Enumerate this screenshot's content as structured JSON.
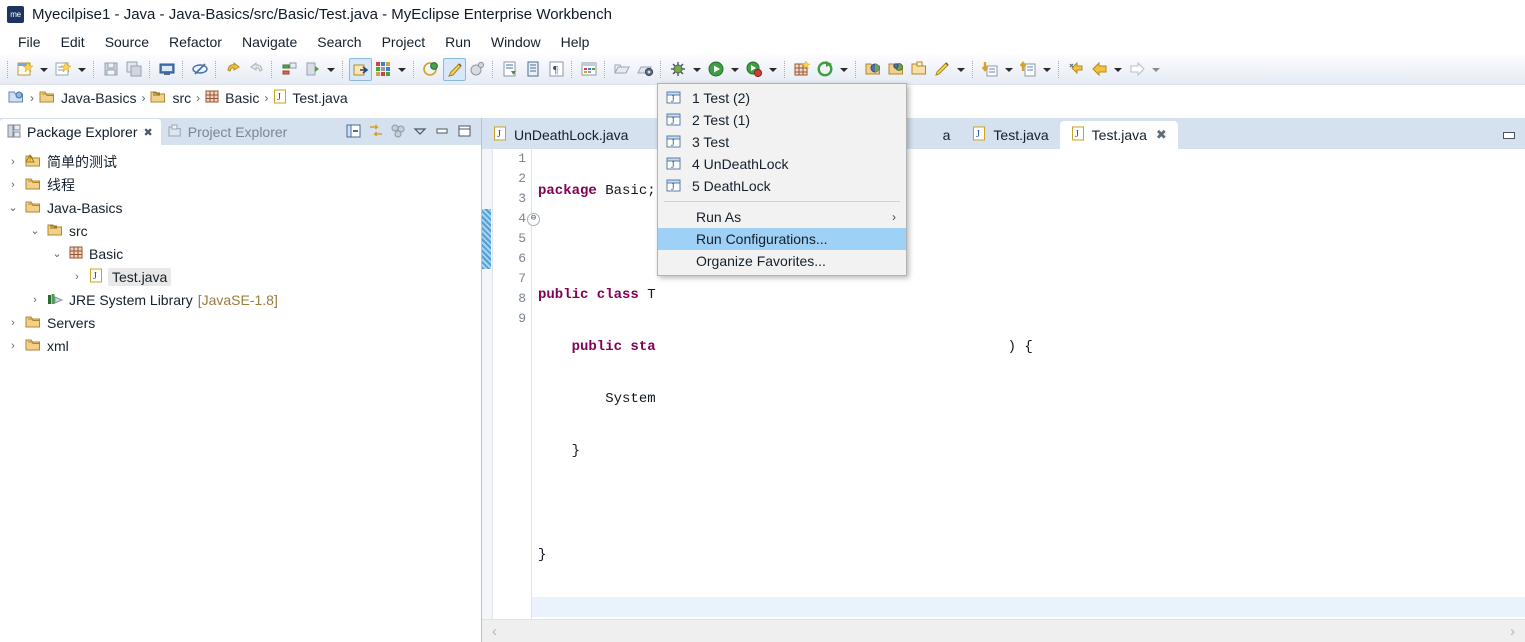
{
  "window": {
    "app_icon": "me",
    "title": "Myecilpise1 - Java - Java-Basics/src/Basic/Test.java - MyEclipse Enterprise Workbench"
  },
  "menubar": {
    "items": [
      {
        "label": "File"
      },
      {
        "label": "Edit"
      },
      {
        "label": "Source"
      },
      {
        "label": "Refactor"
      },
      {
        "label": "Navigate"
      },
      {
        "label": "Search"
      },
      {
        "label": "Project"
      },
      {
        "label": "Run"
      },
      {
        "label": "Window"
      },
      {
        "label": "Help"
      }
    ]
  },
  "toolbar": {
    "icons": [
      "new-wizard-icon",
      "new-wizard-dropdown",
      "new-java-class-icon",
      "new-java-class-dropdown",
      "save-icon",
      "save-all-icon",
      "console-icon",
      "no-marker-icon",
      "undo-icon",
      "redo-icon",
      "import-export-icon",
      "deploy-icon",
      "deploy-dropdown",
      "open-perspective-icon",
      "color-palette-icon",
      "color-palette-dropdown",
      "db-browser-icon",
      "paint-brush-icon",
      "properties-icon",
      "java-doc-icon",
      "open-type-icon",
      "pilcrow-icon",
      "table-icon",
      "open-resource-icon",
      "snapshot-icon",
      "debug-icon",
      "debug-dropdown",
      "run-icon",
      "run-dropdown",
      "run-error-icon",
      "run-error-dropdown",
      "new-table-icon",
      "refresh-icon",
      "refresh-dropdown",
      "open-package-icon",
      "open-folder-icon",
      "open-archive-icon",
      "pencil-icon",
      "pencil-dropdown",
      "download-icon",
      "download-dropdown",
      "upload-icon",
      "upload-dropdown",
      "back-history-icon",
      "back-icon",
      "back-dropdown",
      "forward-icon",
      "forward-dropdown"
    ]
  },
  "breadcrumb": {
    "items": [
      {
        "label": "",
        "icon": "workspace-icon"
      },
      {
        "label": "Java-Basics",
        "icon": "project-icon"
      },
      {
        "label": "src",
        "icon": "source-folder-icon"
      },
      {
        "label": "Basic",
        "icon": "package-icon"
      },
      {
        "label": "Test.java",
        "icon": "java-file-icon"
      }
    ],
    "separator": "›"
  },
  "explorer": {
    "tabs": [
      {
        "label": "Package Explorer",
        "active": true,
        "closable": true,
        "icon": "package-explorer-icon"
      },
      {
        "label": "Project Explorer",
        "active": false,
        "closable": false,
        "icon": "project-explorer-icon"
      }
    ],
    "tools": [
      "collapse-all-icon",
      "link-with-editor-icon",
      "view-menu-dots-icon",
      "view-menu-icon",
      "minimize-icon",
      "maximize-icon"
    ],
    "tree": [
      {
        "label": "简单的测试",
        "indent": 0,
        "twist": "collapsed",
        "icon": "project-warning-icon",
        "selected": false,
        "suffix": ""
      },
      {
        "label": "线程",
        "indent": 0,
        "twist": "collapsed",
        "icon": "project-icon",
        "selected": false,
        "suffix": ""
      },
      {
        "label": "Java-Basics",
        "indent": 0,
        "twist": "expanded",
        "icon": "project-icon",
        "selected": false,
        "suffix": ""
      },
      {
        "label": "src",
        "indent": 1,
        "twist": "expanded",
        "icon": "source-folder-icon",
        "selected": false,
        "suffix": ""
      },
      {
        "label": "Basic",
        "indent": 2,
        "twist": "expanded",
        "icon": "package-icon",
        "selected": false,
        "suffix": ""
      },
      {
        "label": "Test.java",
        "indent": 3,
        "twist": "collapsed",
        "icon": "java-file-icon",
        "selected": true,
        "suffix": ""
      },
      {
        "label": "JRE System Library",
        "indent": 1,
        "twist": "collapsed",
        "icon": "library-icon",
        "selected": false,
        "suffix": "[JavaSE-1.8]"
      },
      {
        "label": "Servers",
        "indent": 0,
        "twist": "collapsed",
        "icon": "project-icon",
        "selected": false,
        "suffix": ""
      },
      {
        "label": "xml",
        "indent": 0,
        "twist": "collapsed",
        "icon": "project-icon",
        "selected": false,
        "suffix": ""
      }
    ]
  },
  "editor": {
    "tabs": [
      {
        "label": "UnDeathLock.java",
        "active": false,
        "closable": false,
        "icon": "java-file-icon"
      },
      {
        "label": "a",
        "active": false,
        "closable": false,
        "icon": "java-file-icon"
      },
      {
        "label": "Test.java",
        "active": false,
        "closable": false,
        "icon": "java-file-icon"
      },
      {
        "label": "Test.java",
        "active": true,
        "closable": true,
        "icon": "java-file-icon"
      }
    ],
    "minimize_icon": "minimize-icon",
    "close_glyph": "✖",
    "lines": [
      {
        "num": "1",
        "fold": false,
        "current": false,
        "changed": false,
        "tokens": [
          {
            "t": "package ",
            "c": "kw"
          },
          {
            "t": "Basic;",
            "c": "plain"
          }
        ]
      },
      {
        "num": "2",
        "fold": false,
        "current": false,
        "changed": false,
        "tokens": []
      },
      {
        "num": "3",
        "fold": false,
        "current": false,
        "changed": false,
        "tokens": [
          {
            "t": "public class ",
            "c": "kw"
          },
          {
            "t": "T",
            "c": "plain"
          }
        ]
      },
      {
        "num": "4",
        "fold": true,
        "current": false,
        "changed": true,
        "tokens": [
          {
            "t": "    public sta",
            "c": "kw"
          }
        ]
      },
      {
        "num": "5",
        "fold": false,
        "current": false,
        "changed": true,
        "tokens": [
          {
            "t": "        System",
            "c": "plain"
          }
        ]
      },
      {
        "num": "6",
        "fold": false,
        "current": false,
        "changed": true,
        "tokens": [
          {
            "t": "    }",
            "c": "plain"
          }
        ]
      },
      {
        "num": "7",
        "fold": false,
        "current": false,
        "changed": false,
        "tokens": []
      },
      {
        "num": "8",
        "fold": false,
        "current": false,
        "changed": false,
        "tokens": [
          {
            "t": "}",
            "c": "plain"
          }
        ]
      },
      {
        "num": "9",
        "fold": false,
        "current": true,
        "changed": false,
        "tokens": []
      }
    ],
    "occluded_code": ") {",
    "fold_glyph": "⊖",
    "scroll_left_glyph": "‹",
    "scroll_right_glyph": "›"
  },
  "run_menu": {
    "items": [
      {
        "label": "1 Test (2)",
        "icon": "java-launch-icon",
        "type": "icon",
        "highlight": false
      },
      {
        "label": "2 Test (1)",
        "icon": "java-launch-icon",
        "type": "icon",
        "highlight": false
      },
      {
        "label": "3 Test",
        "icon": "java-launch-icon",
        "type": "icon",
        "highlight": false
      },
      {
        "label": "4 UnDeathLock",
        "icon": "java-launch-icon",
        "type": "icon",
        "highlight": false
      },
      {
        "label": "5 DeathLock",
        "icon": "java-launch-icon",
        "type": "icon",
        "highlight": false
      },
      {
        "type": "separator"
      },
      {
        "label": "Run As",
        "type": "submenu",
        "highlight": false,
        "arrow": "›"
      },
      {
        "label": "Run Configurations...",
        "type": "plain",
        "highlight": true
      },
      {
        "label": "Organize Favorites...",
        "type": "plain",
        "highlight": false
      }
    ]
  },
  "colors": {
    "menu_highlight": "#9fd0f5",
    "tab_bar": "#d5e1ef",
    "keyword": "#7f0055",
    "current_line": "#eaf2fc",
    "link_text": "#9a7b3f"
  }
}
